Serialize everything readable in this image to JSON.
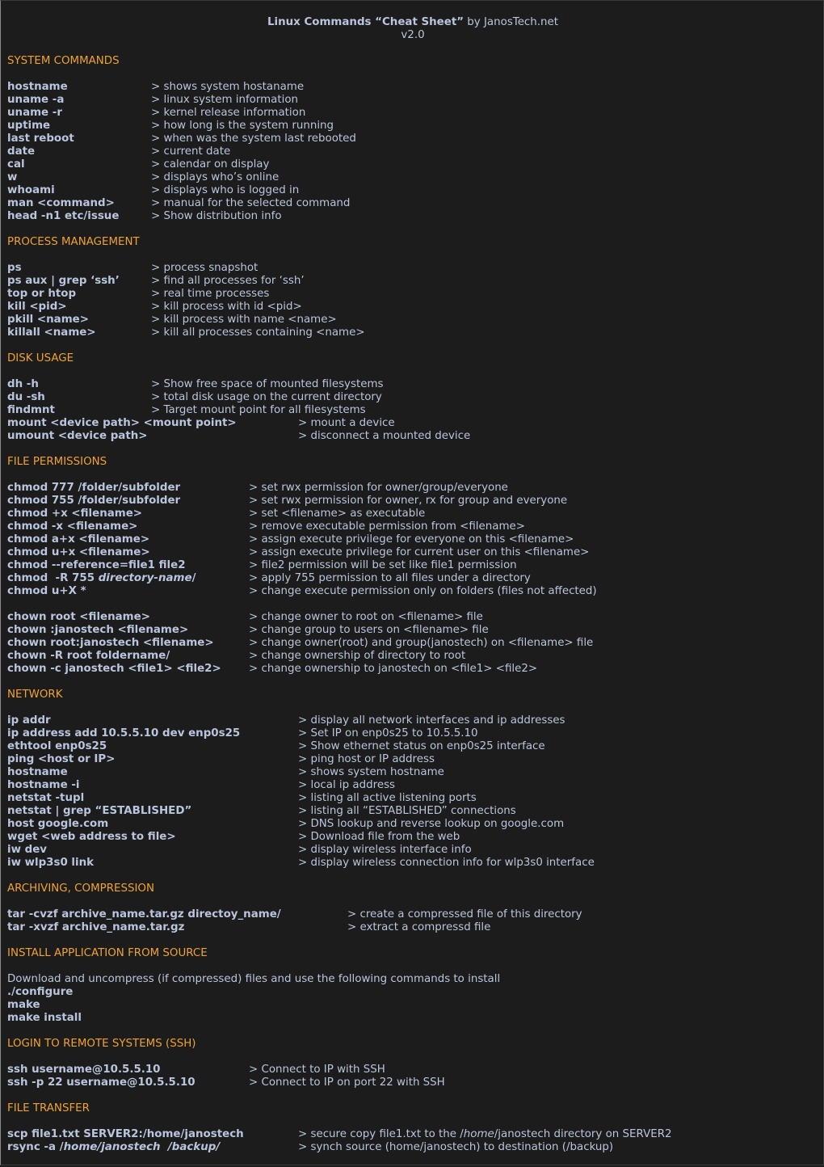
{
  "header": {
    "title_bold": "Linux Commands “Cheat Sheet”",
    "title_rest": " by JanosTech.net",
    "version": "v2.0"
  },
  "colors": {
    "background": "#1c1c1c",
    "heading": "#f0a22e",
    "text": "#b9c5dc"
  },
  "sections": {
    "system": {
      "title": "SYSTEM COMMANDS",
      "rows": [
        {
          "cmd": "hostname",
          "desc": "> shows system hostaname"
        },
        {
          "cmd": "uname -a",
          "desc": "> linux system information"
        },
        {
          "cmd": "uname -r",
          "desc": "> kernel release information"
        },
        {
          "cmd": "uptime",
          "desc": "> how long is the system running"
        },
        {
          "cmd": "last reboot",
          "desc": "> when was the system last rebooted"
        },
        {
          "cmd": "date",
          "desc": "> current date"
        },
        {
          "cmd": "cal",
          "desc": "> calendar on display"
        },
        {
          "cmd": "w",
          "desc": "> displays who’s online"
        },
        {
          "cmd": "whoami",
          "desc": "> displays who is logged in"
        },
        {
          "cmd": "man <command>",
          "desc": "> manual for the selected command"
        },
        {
          "cmd": "head -n1 etc/issue",
          "desc": "> Show distribution info"
        }
      ]
    },
    "process": {
      "title": "PROCESS MANAGEMENT",
      "rows": [
        {
          "cmd": "ps",
          "desc": "> process snapshot"
        },
        {
          "cmd": "ps aux | grep ‘ssh’",
          "desc": "> find all processes for ‘ssh’"
        },
        {
          "cmd": "top or htop",
          "desc": "> real time processes"
        },
        {
          "cmd": "kill <pid>",
          "desc": "> kill process with id <pid>"
        },
        {
          "cmd": "pkill <name>",
          "desc": "> kill process with name <name>"
        },
        {
          "cmd": "killall <name>",
          "desc": "> kill all processes containing <name>"
        }
      ]
    },
    "disk": {
      "title": "DISK USAGE",
      "rows": [
        {
          "cmd": "dh -h",
          "desc": "> Show free space of mounted filesystems"
        },
        {
          "cmd": "du -sh",
          "desc": "> total disk usage on the current directory"
        },
        {
          "cmd": "findmnt",
          "desc": "> Target mount point for all filesystems"
        },
        {
          "cmd": "mount <device path> <mount point>",
          "desc": "> mount a device"
        },
        {
          "cmd": "umount <device path>",
          "desc": "> disconnect a mounted device"
        }
      ]
    },
    "permissions": {
      "title": "FILE PERMISSIONS",
      "chmod_rows": [
        {
          "cmd": "chmod 777 /folder/subfolder",
          "desc": "> set rwx permission for owner/group/everyone"
        },
        {
          "cmd": "chmod 755 /folder/subfolder",
          "desc": "> set rwx permission for owner, rx for group and everyone"
        },
        {
          "cmd": "chmod +x <filename>",
          "desc": "> set <filename> as executable"
        },
        {
          "cmd": "chmod -x <filename>",
          "desc": "> remove executable permission from <filename>"
        },
        {
          "cmd": "chmod a+x <filename>",
          "desc": "> assign execute privilege for everyone on this <filename>"
        },
        {
          "cmd": "chmod u+x <filename>",
          "desc": "> assign execute privilege for current user on this <filename>"
        },
        {
          "cmd": "chmod --reference=file1 file2",
          "desc": "> file2 permission will be set like file1 permission"
        },
        {
          "cmd_prefix": "chmod  -R 755 ",
          "cmd_italic": "directory-name",
          "cmd_suffix": "/",
          "desc": "> apply 755 permission to all files under a directory"
        },
        {
          "cmd": "chmod u+X *",
          "desc": "> change execute permission only on folders (files not affected)"
        }
      ],
      "chown_rows": [
        {
          "cmd": "chown root <filename>",
          "desc": "> change owner to root on <filename> file"
        },
        {
          "cmd": "chown :janostech <filename>",
          "desc": "> change group to users on <filename> file"
        },
        {
          "cmd": "chown root:janostech <filename>",
          "desc": "> change owner(root) and group(janostech) on <filename> file"
        },
        {
          "cmd": "chown -R root foldername/",
          "desc": "> change ownership of directory to root"
        },
        {
          "cmd": "chown -c janostech <file1> <file2>",
          "desc": "> change ownership to janostech on <file1> <file2>"
        }
      ]
    },
    "network": {
      "title": "NETWORK",
      "rows": [
        {
          "cmd": "ip addr",
          "desc": "> display all network interfaces and ip addresses"
        },
        {
          "cmd": "ip address add 10.5.5.10 dev enp0s25",
          "desc": "> Set IP on enp0s25 to 10.5.5.10"
        },
        {
          "cmd": "ethtool enp0s25",
          "desc": "> Show ethernet status on enp0s25 interface"
        },
        {
          "cmd": "ping <host or IP>",
          "desc": "> ping host or IP address"
        },
        {
          "cmd": "hostname",
          "desc": "> shows system hostname"
        },
        {
          "cmd": "hostname -i",
          "desc": "> local ip address"
        },
        {
          "cmd": "netstat -tupl",
          "desc": "> listing all active listening ports"
        },
        {
          "cmd": "netstat | grep “ESTABLISHED”",
          "desc": "> listing all “ESTABLISHED” connections"
        },
        {
          "cmd": "host google.com",
          "desc": "> DNS lookup and reverse lookup on google.com"
        },
        {
          "cmd": "wget <web address to file>",
          "desc": "> Download file from the web"
        },
        {
          "cmd": "iw dev",
          "desc": "> display wireless interface info"
        },
        {
          "cmd": "iw wlp3s0 link",
          "desc": "> display wireless connection info for wlp3s0 interface"
        }
      ]
    },
    "archiving": {
      "title": "ARCHIVING, COMPRESSION",
      "rows": [
        {
          "cmd": "tar -cvzf archive_name.tar.gz directoy_name/",
          "desc": "> create a compressed file of this directory"
        },
        {
          "cmd": "tar -xvzf archive_name.tar.gz",
          "desc": "> extract a compressd file"
        }
      ]
    },
    "install": {
      "title": "INSTALL APPLICATION FROM SOURCE",
      "intro": "Download and uncompress (if compressed) files and use the following commands to install",
      "commands": [
        "./configure",
        "make",
        "make install"
      ]
    },
    "ssh": {
      "title": "LOGIN TO REMOTE SYSTEMS (SSH)",
      "rows": [
        {
          "cmd": "ssh username@10.5.5.10",
          "desc": "> Connect to IP with SSH"
        },
        {
          "cmd": "ssh -p 22 username@10.5.5.10",
          "desc": "> Connect to IP on port 22 with SSH"
        }
      ]
    },
    "transfer": {
      "title": "FILE TRANSFER",
      "scp": {
        "cmd": "scp file1.txt SERVER2:/home/janostech",
        "desc_prefix": "> secure copy file1.txt to the /",
        "desc_italic": "home",
        "desc_suffix": "/janostech directory on SERVER2"
      },
      "rsync": {
        "cmd_prefix": "rsync -a /",
        "cmd_italic": "home/janostech  /backup/",
        "desc": "> synch source (home/janostech) to destination (/backup)"
      }
    }
  }
}
